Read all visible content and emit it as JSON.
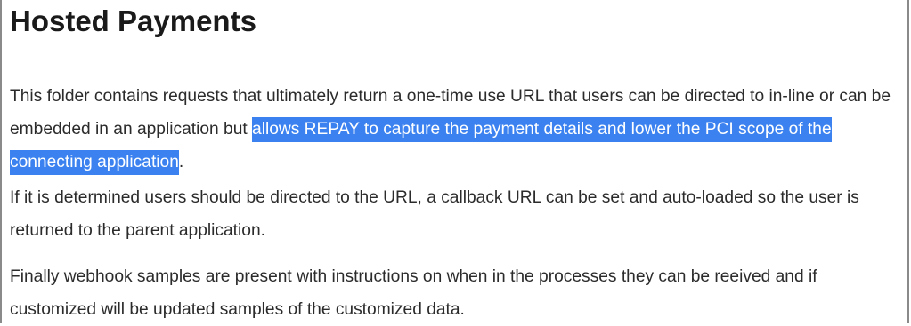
{
  "title": "Hosted Payments",
  "paragraphs": {
    "p1_before": "This folder contains requests that ultimately return a one-time use URL that users can be directed to in-line or can be embedded in an application but ",
    "p1_highlight": "allows REPAY to capture the payment details and lower the PCI scope of the connecting application",
    "p1_after": ".",
    "p2": "If it is determined users should be directed to the URL, a callback URL can be set and auto-loaded so the user is returned to the parent application.",
    "p3": "Finally webhook samples are present with instructions on when in the processes they can be reeived and if customized will be updated samples of the customized data."
  },
  "colors": {
    "highlight": "#3b82f0",
    "text": "#2b2b2b"
  }
}
